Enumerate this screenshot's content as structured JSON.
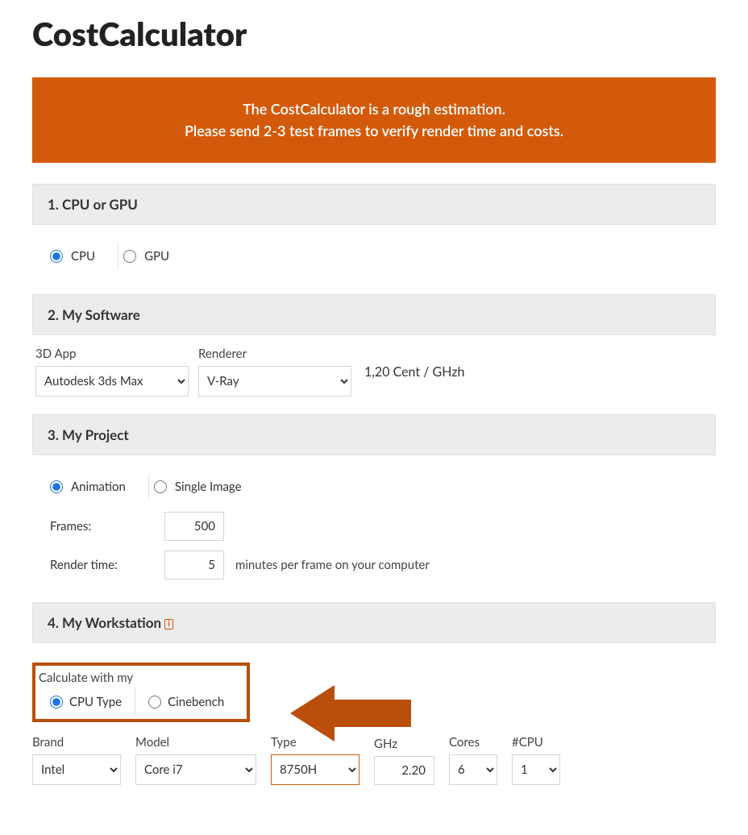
{
  "page": {
    "title": "CostCalculator"
  },
  "banner": {
    "line1": "The CostCalculator is a rough estimation.",
    "line2": "Please send 2-3 test frames to verify render time and costs."
  },
  "sections": {
    "s1": {
      "header": "1. CPU or GPU"
    },
    "s2": {
      "header": "2. My Software"
    },
    "s3": {
      "header": "3. My Project"
    },
    "s4": {
      "header": "4. My Workstation"
    }
  },
  "cpu_gpu": {
    "cpu_label": "CPU",
    "gpu_label": "GPU"
  },
  "software": {
    "app_label": "3D App",
    "app_value": "Autodesk 3ds Max",
    "renderer_label": "Renderer",
    "renderer_value": "V-Ray",
    "price_text": "1,20 Cent / GHzh"
  },
  "project": {
    "animation_label": "Animation",
    "single_label": "Single Image",
    "frames_label": "Frames:",
    "frames_value": "500",
    "rendertime_label": "Render time:",
    "rendertime_value": "5",
    "rendertime_after": "minutes per frame on your computer"
  },
  "workstation": {
    "info_glyph": "i",
    "calc_label": "Calculate with my",
    "cpu_type_label": "CPU Type",
    "cinebench_label": "Cinebench",
    "brand_label": "Brand",
    "brand_value": "Intel",
    "model_label": "Model",
    "model_value": "Core i7",
    "type_label": "Type",
    "type_value": "8750H",
    "ghz_label": "GHz",
    "ghz_value": "2.20",
    "cores_label": "Cores",
    "cores_value": "6",
    "numcpu_label": "#CPU",
    "numcpu_value": "1"
  }
}
